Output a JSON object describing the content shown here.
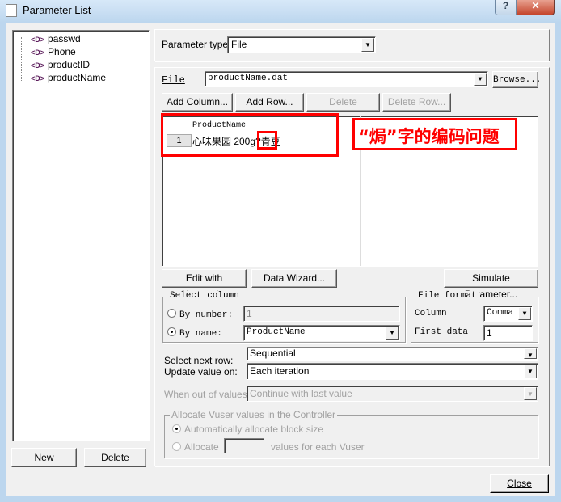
{
  "window": {
    "title": "Parameter List",
    "help_label": "?",
    "close_label": "✕"
  },
  "tree": {
    "items": [
      {
        "label": "passwd"
      },
      {
        "label": "Phone"
      },
      {
        "label": "productID"
      },
      {
        "label": "productName"
      }
    ],
    "icon_glyph": "<D>"
  },
  "left_buttons": {
    "new": "New",
    "delete": "Delete"
  },
  "param_type": {
    "label": "Parameter type:",
    "value": "File"
  },
  "file": {
    "label": "File",
    "value": "productName.dat",
    "browse": "Browse..."
  },
  "table_buttons": {
    "add_column": "Add Column...",
    "add_row": "Add Row...",
    "delete_column": "Delete Column...",
    "delete_row": "Delete Row..."
  },
  "table": {
    "header": "ProductName",
    "rows": [
      {
        "num": "1",
        "value": "心味果园 200g?青豆"
      }
    ]
  },
  "annotation": {
    "text": "“焗”字的编码问题",
    "color": "#ff0000"
  },
  "action_buttons": {
    "notepad": "Edit with Notepad...",
    "wizard": "Data Wizard...",
    "simulate": "Simulate Parameter..."
  },
  "select_column": {
    "title": "Select column",
    "by_number": "By number:",
    "number_value": "1",
    "by_name": "By name:",
    "name_value": "ProductName",
    "selected": "by_name"
  },
  "file_format": {
    "title": "File format",
    "column_label": "Column",
    "column_value": "Comma",
    "first_data_label": "First data",
    "first_data_value": "1"
  },
  "next_row": {
    "label": "Select next row:",
    "value": "Sequential"
  },
  "update": {
    "label": "Update value on:",
    "value": "Each iteration"
  },
  "out_of_values": {
    "label": "When out of values:",
    "value": "Continue with last value"
  },
  "allocate": {
    "title": "Allocate Vuser values in the Controller",
    "auto": "Automatically allocate block size",
    "manual": "Allocate",
    "manual_suffix": "values for each Vuser",
    "manual_value": ""
  },
  "close_button": "Close"
}
